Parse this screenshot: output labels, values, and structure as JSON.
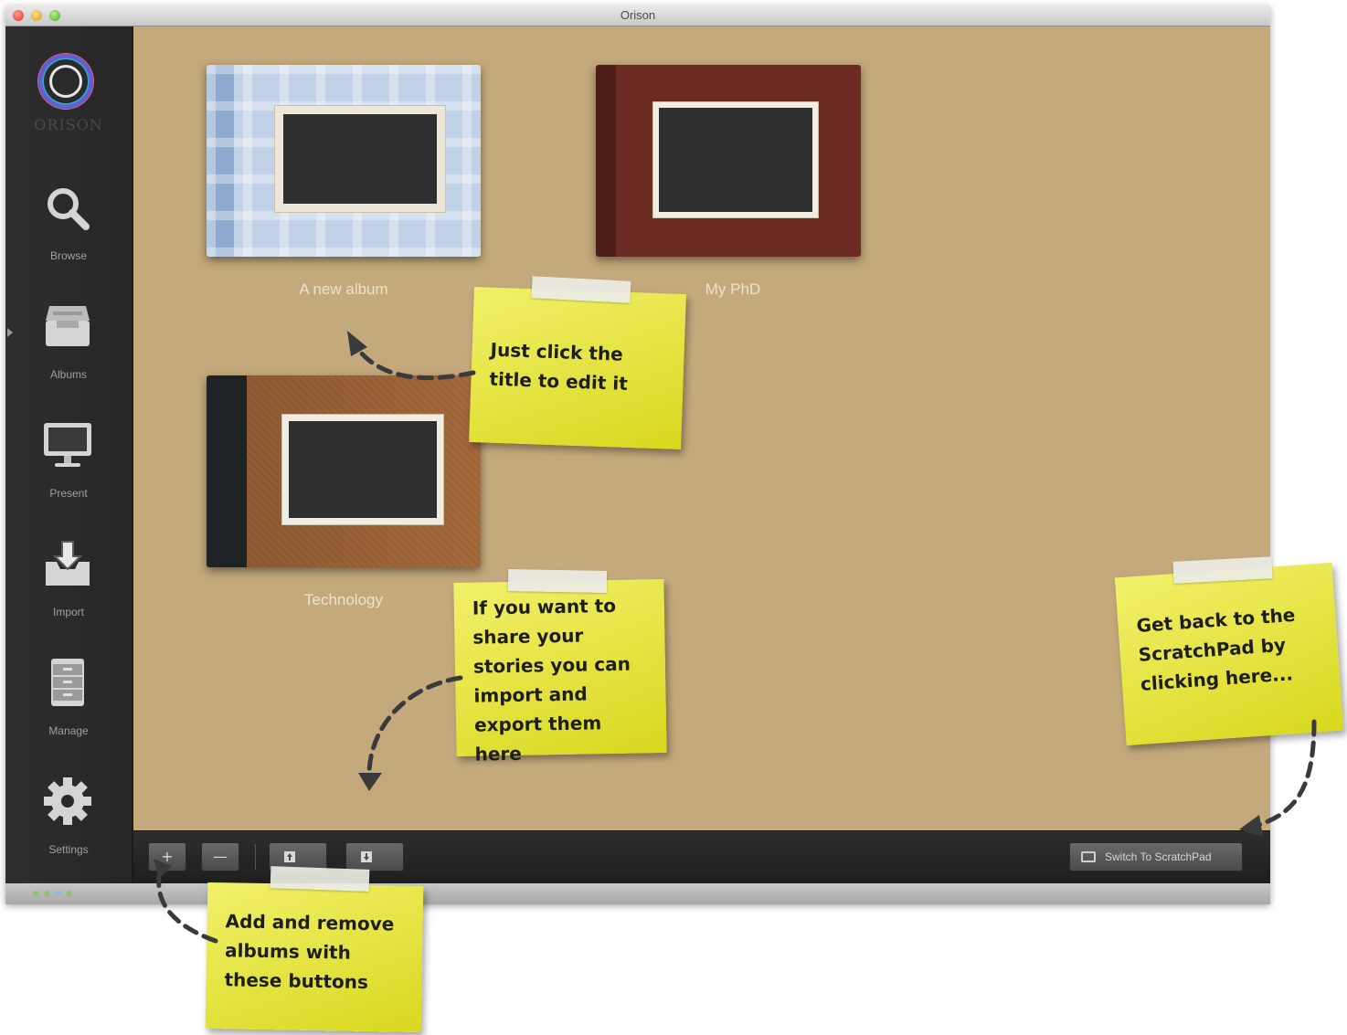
{
  "window": {
    "title": "Orison"
  },
  "sidebar": {
    "logo_text": "ORISON",
    "items": [
      {
        "label": "Browse",
        "icon": "search-icon"
      },
      {
        "label": "Albums",
        "icon": "inbox-tray-icon"
      },
      {
        "label": "Present",
        "icon": "monitor-icon"
      },
      {
        "label": "Import",
        "icon": "import-tray-icon"
      },
      {
        "label": "Manage",
        "icon": "cabinet-icon"
      },
      {
        "label": "Settings",
        "icon": "gear-icon"
      }
    ],
    "selected": "Albums"
  },
  "albums": [
    {
      "title": "A new album",
      "cover": "light-blue-plaid"
    },
    {
      "title": "My PhD",
      "cover": "dark-red-leather"
    },
    {
      "title": "Technology",
      "cover": "brown-burlap"
    }
  ],
  "toolbar": {
    "add_glyph": "+",
    "remove_glyph": "—",
    "switch_label": "Switch To ScratchPad"
  },
  "notes": {
    "title_edit": "Just click the title to edit it",
    "import_export": "If you want to share your stories you can import and export them here",
    "add_remove": "Add and remove albums with these buttons",
    "scratchpad": "Get back to the ScratchPad by clicking here..."
  },
  "colors": {
    "background": "#c4a97c",
    "sidebar": "#2a2a2a",
    "note": "#e8e838",
    "album_blue": "#b9cce6",
    "album_red": "#6b2a22",
    "album_brown": "#8f5a32"
  }
}
